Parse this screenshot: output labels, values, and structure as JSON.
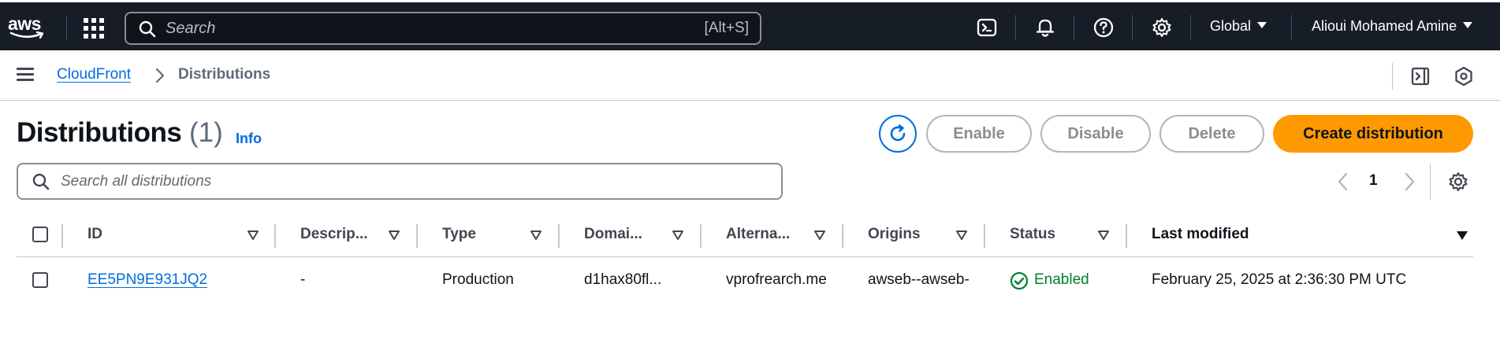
{
  "topnav": {
    "logo_text": "aws",
    "search_placeholder": "Search",
    "search_shortcut": "[Alt+S]",
    "region": "Global",
    "user": "Alioui Mohamed Amine"
  },
  "breadcrumb": {
    "service": "CloudFront",
    "current": "Distributions"
  },
  "header": {
    "title": "Distributions",
    "count": "(1)",
    "info": "Info",
    "buttons": {
      "enable": "Enable",
      "disable": "Disable",
      "delete": "Delete",
      "create": "Create distribution"
    }
  },
  "filter": {
    "placeholder": "Search all distributions"
  },
  "pagination": {
    "current_page": "1"
  },
  "table": {
    "columns": [
      "ID",
      "Descrip...",
      "Type",
      "Domai...",
      "Alterna...",
      "Origins",
      "Status",
      "Last modified"
    ],
    "rows": [
      {
        "id": "EE5PN9E931JQ2",
        "description": "-",
        "type": "Production",
        "domain": "d1hax80fl...",
        "alternate": "vprofrearch.me",
        "origins": "awseb--awseb-",
        "status": "Enabled",
        "last_modified": "February 25, 2025 at 2:36:30 PM UTC"
      }
    ]
  },
  "colors": {
    "nav_bg": "#161d26",
    "link": "#006ce0",
    "primary": "#ff9900",
    "success": "#00802f"
  }
}
